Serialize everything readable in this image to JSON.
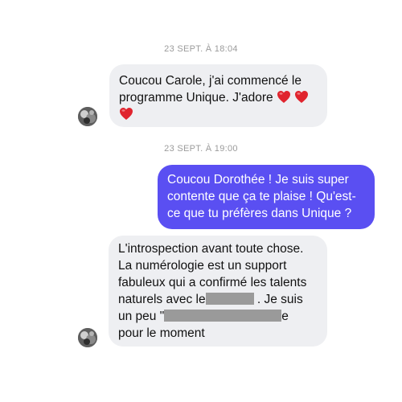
{
  "conversation": {
    "timestamps": [
      "23 SEPT. À 18:04",
      "23 SEPT. À 19:00"
    ],
    "messages": [
      {
        "direction": "incoming",
        "lines": [
          "Coucou Carole, j'ai commencé le",
          "programme Unique. J'adore"
        ],
        "emoji": "red-heart"
      },
      {
        "direction": "outgoing",
        "lines": [
          "Coucou Dorothée ! Je suis super",
          "contente que ça te plaise ! Qu'est-",
          "ce que tu préfères dans Unique ?"
        ]
      },
      {
        "direction": "incoming",
        "lines": [
          "L'introspection avant toute chose.",
          "La numérologie est un support",
          "fabuleux qui a confirmé les talents"
        ],
        "line4_start": "naturels avec le",
        "line4_end": ". Je suis",
        "line5_start": "un peu \"",
        "line5_end": "e",
        "line6": "pour le moment"
      }
    ]
  },
  "colors": {
    "outgoing_bubble": "#5a4ff2",
    "incoming_bubble": "#eeeff2",
    "timestamp_text": "#9b9b9b",
    "heart": "#e0242e"
  }
}
